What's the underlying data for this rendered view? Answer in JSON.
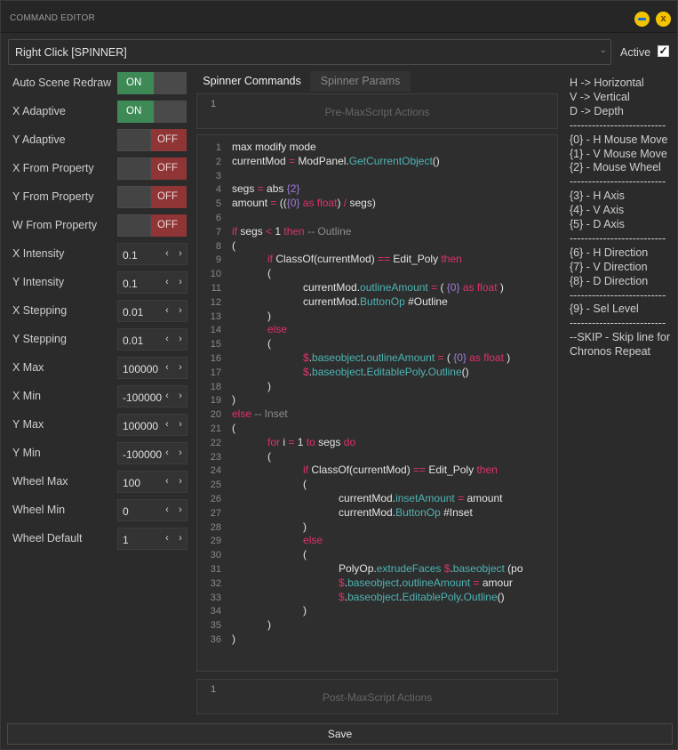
{
  "window": {
    "title": "COMMAND EDITOR"
  },
  "combo": {
    "value": "Right Click [SPINNER]"
  },
  "active": {
    "label": "Active",
    "checked": "✓"
  },
  "toggles": [
    {
      "label": "Auto Scene Redraw",
      "state": "ON"
    },
    {
      "label": "X Adaptive",
      "state": "ON"
    },
    {
      "label": "Y Adaptive",
      "state": "OFF"
    },
    {
      "label": "X From Property",
      "state": "OFF"
    },
    {
      "label": "Y From Property",
      "state": "OFF"
    },
    {
      "label": "W From Property",
      "state": "OFF"
    }
  ],
  "fields": [
    {
      "label": "X Intensity",
      "value": "0.1"
    },
    {
      "label": "Y Intensity",
      "value": "0.1"
    },
    {
      "label": "X Stepping",
      "value": "0.01"
    },
    {
      "label": "Y Stepping",
      "value": "0.01"
    },
    {
      "label": "X Max",
      "value": "100000"
    },
    {
      "label": "X Min",
      "value": "-100000"
    },
    {
      "label": "Y Max",
      "value": "100000"
    },
    {
      "label": "Y Min",
      "value": "-100000"
    },
    {
      "label": "Wheel Max",
      "value": "100"
    },
    {
      "label": "Wheel Min",
      "value": "0"
    },
    {
      "label": "Wheel Default",
      "value": "1"
    }
  ],
  "tabs": [
    {
      "label": "Spinner Commands"
    },
    {
      "label": "Spinner Params"
    }
  ],
  "pre": {
    "line": "1",
    "placeholder": "Pre-MaxScript Actions"
  },
  "post": {
    "line": "1",
    "placeholder": "Post-MaxScript Actions"
  },
  "code": [
    "max modify mode",
    "currentMod = ModPanel.GetCurrentObject()",
    "",
    "segs = abs {2}",
    "amount = (({0} as float) / segs)",
    "",
    "if segs < 1 then -- Outline",
    "(",
    "\t\tif ClassOf(currentMod) == Edit_Poly then",
    "\t\t(",
    "\t\t\t\tcurrentMod.outlineAmount = ( {0} as float )",
    "\t\t\t\tcurrentMod.ButtonOp #Outline",
    "\t\t)",
    "\t\telse",
    "\t\t(",
    "\t\t\t\t$.baseobject.outlineAmount = ( {0} as float )",
    "\t\t\t\t$.baseobject.EditablePoly.Outline()",
    "\t\t)",
    ")",
    "else -- Inset",
    "(",
    "\t\tfor i = 1 to segs do",
    "\t\t(",
    "\t\t\t\tif ClassOf(currentMod) == Edit_Poly then",
    "\t\t\t\t(",
    "\t\t\t\t\t\tcurrentMod.insetAmount = amount",
    "\t\t\t\t\t\tcurrentMod.ButtonOp #Inset",
    "\t\t\t\t)",
    "\t\t\t\telse",
    "\t\t\t\t(",
    "\t\t\t\t\t\tPolyOp.extrudeFaces $.baseobject (po",
    "\t\t\t\t\t\t$.baseobject.outlineAmount = amour",
    "\t\t\t\t\t\t$.baseobject.EditablePoly.Outline()",
    "\t\t\t\t)",
    "\t\t)",
    ")"
  ],
  "help": [
    "H -> Horizontal",
    "V -> Vertical",
    "D -> Depth",
    "--------------------------",
    "{0} - H Mouse Move",
    "{1} - V Mouse Move",
    "{2} - Mouse Wheel",
    "--------------------------",
    "{3} - H Axis",
    "{4} - V Axis",
    "{5} - D Axis",
    "--------------------------",
    "{6} - H Direction",
    "{7} - V Direction",
    "{8} - D Direction",
    "--------------------------",
    "{9} - Sel Level",
    "--------------------------",
    "--SKIP - Skip line for",
    "Chronos Repeat"
  ],
  "save": {
    "label": "Save"
  },
  "colors": {
    "on": "#3e8a57",
    "off": "#8f3535",
    "keyword": "#e0326a",
    "function": "#4fb3b3",
    "brace": "#9d7cd8"
  }
}
